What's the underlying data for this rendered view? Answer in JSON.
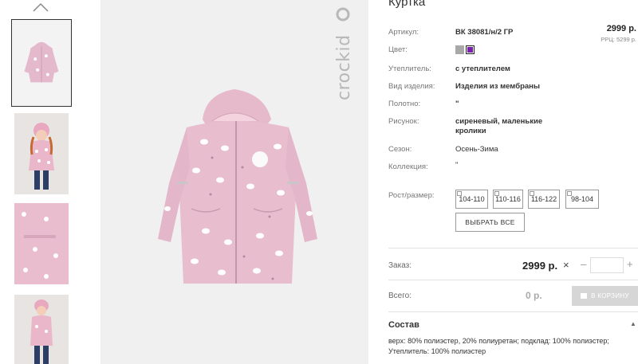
{
  "product": {
    "title": "Куртка",
    "price": "2999 р.",
    "rrp": "РРЦ: 5299 р.",
    "brand_logo_text": "crockid"
  },
  "specs": [
    {
      "label": "Артикул:",
      "value": "ВК 38081/н/2 ГР"
    },
    {
      "label": "Цвет:",
      "value": ""
    },
    {
      "label": "Утеплитель:",
      "value": "с утеплителем"
    },
    {
      "label": "Вид изделия:",
      "value": "Изделия из мембраны"
    },
    {
      "label": "Полотно:",
      "value": "\""
    },
    {
      "label": "Рисунок:",
      "value": "сиреневый, маленькие кролики"
    },
    {
      "label": "Сезон:",
      "value": "Осень-Зима"
    },
    {
      "label": "Коллекция:",
      "value": "\""
    },
    {
      "label": "Рост/размер:",
      "value": ""
    }
  ],
  "colors": [
    {
      "name": "grey",
      "hex": "#a8a8a8",
      "selected": false
    },
    {
      "name": "purple",
      "hex": "#7a1fb0",
      "selected": true
    }
  ],
  "sizes": [
    "104-110",
    "110-116",
    "116-122",
    "98-104"
  ],
  "select_all_label": "ВЫБРАТЬ ВСЕ",
  "order": {
    "label": "Заказ:",
    "price": "2999 р.",
    "times": "×",
    "minus": "–",
    "plus": "+",
    "quantity": ""
  },
  "total": {
    "label": "Всего:",
    "value": "0 р.",
    "cart_label": "В КОРЗИНУ"
  },
  "composition": {
    "title": "Состав",
    "toggle": "▲",
    "text": "верх: 80% полиэстер, 20% полиуретан; подклад: 100% полиэстер; Утеплитель: 100% полиэстер"
  },
  "icons": {
    "thumbs_up": "chevron-up-icon",
    "cart": "cart-icon"
  },
  "palette": {
    "jacket_pink": "#e8c0d0",
    "background_grey": "#f0f0f0"
  }
}
